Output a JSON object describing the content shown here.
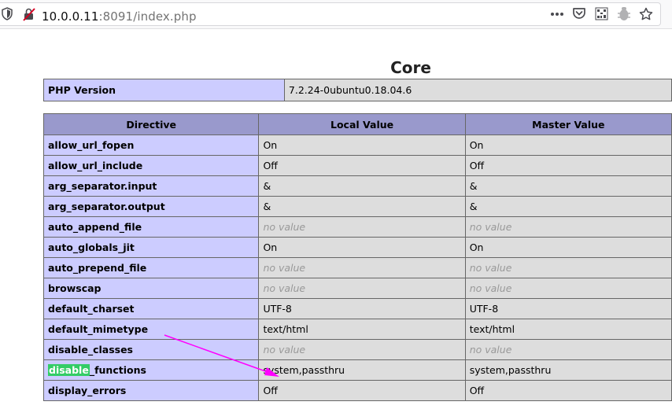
{
  "browser": {
    "url_host": "10.0.0.11",
    "url_rest": ":8091/index.php",
    "icons": [
      "shield-icon",
      "insecure-lock-icon",
      "more-icon",
      "pocket-icon",
      "qr-code-icon",
      "extension-icon",
      "bookmark-star-icon"
    ]
  },
  "page": {
    "section_title": "Core"
  },
  "php_version": {
    "label": "PHP Version",
    "value": "7.2.24-0ubuntu0.18.04.6"
  },
  "directives": {
    "headers": [
      "Directive",
      "Local Value",
      "Master Value"
    ],
    "no_value_text": "no value",
    "rows": [
      {
        "name": "allow_url_fopen",
        "local": "On",
        "master": "On"
      },
      {
        "name": "allow_url_include",
        "local": "Off",
        "master": "Off"
      },
      {
        "name": "arg_separator.input",
        "local": "&",
        "master": "&"
      },
      {
        "name": "arg_separator.output",
        "local": "&",
        "master": "&"
      },
      {
        "name": "auto_append_file",
        "local": "no value",
        "master": "no value"
      },
      {
        "name": "auto_globals_jit",
        "local": "On",
        "master": "On"
      },
      {
        "name": "auto_prepend_file",
        "local": "no value",
        "master": "no value"
      },
      {
        "name": "browscap",
        "local": "no value",
        "master": "no value"
      },
      {
        "name": "default_charset",
        "local": "UTF-8",
        "master": "UTF-8"
      },
      {
        "name": "default_mimetype",
        "local": "text/html",
        "master": "text/html"
      },
      {
        "name": "disable_classes",
        "local": "no value",
        "master": "no value"
      },
      {
        "name": "disable_functions",
        "name_highlight": "disable",
        "name_rest": "_functions",
        "local": "system,passthru",
        "master": "system,passthru"
      },
      {
        "name": "display_errors",
        "local": "Off",
        "master": "Off"
      }
    ]
  },
  "colors": {
    "header_bg": "#9999cc",
    "directive_bg": "#ccccff",
    "value_bg": "#dddddd",
    "highlight": "#33cc66",
    "annotation_arrow": "#ff00ff"
  }
}
